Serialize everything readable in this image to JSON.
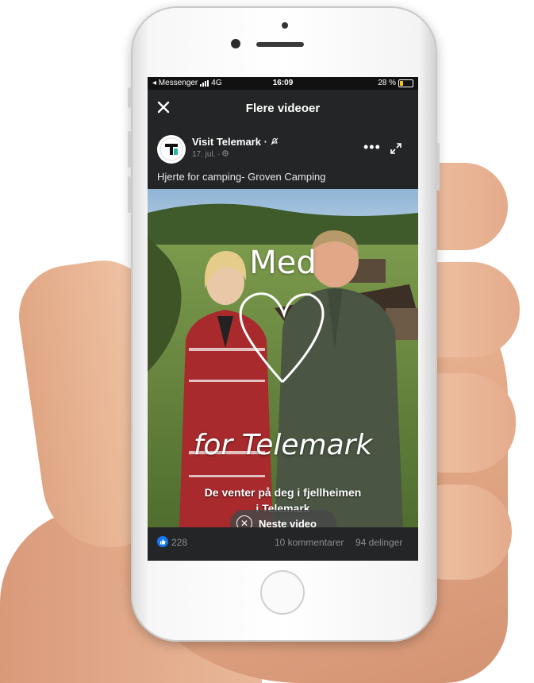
{
  "status_bar": {
    "back_app": "◂ Messenger",
    "network": "4G",
    "time": "16:09",
    "battery_text": "28 %"
  },
  "header": {
    "title": "Flere videoer"
  },
  "post": {
    "page_name": "Visit Telemark",
    "separator": "·",
    "date": "17. jul. ·",
    "caption": "Hjerte for camping- Groven Camping"
  },
  "video": {
    "title_line1": "Med",
    "title_line2": "for Telemark",
    "subtitle_line1": "De venter på deg i fjellheimen",
    "subtitle_line2": "i Telemark",
    "next_label": "Neste video"
  },
  "footer": {
    "likes": "228",
    "comments": "10 kommentarer",
    "shares": "94 delinger"
  },
  "colors": {
    "screen_bg": "#242526",
    "like_blue": "#1877f2",
    "battery_yellow": "#f5c518"
  }
}
